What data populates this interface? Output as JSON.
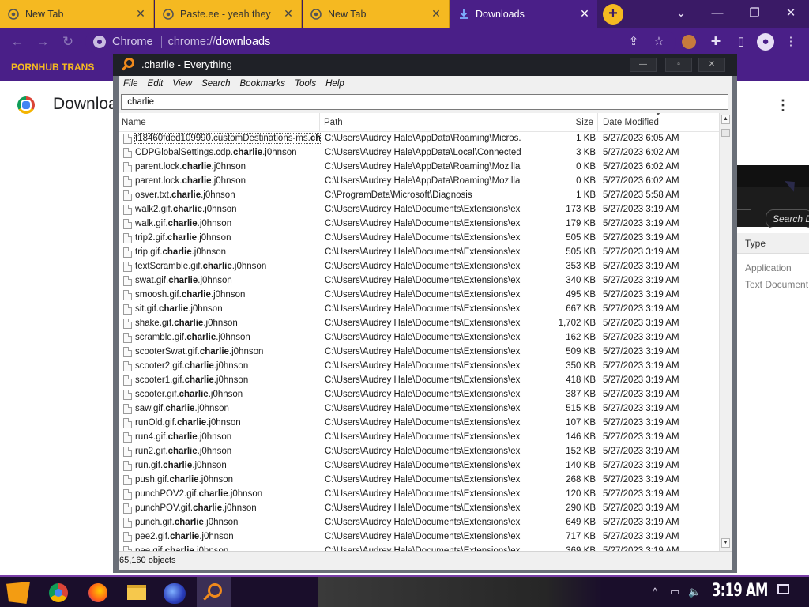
{
  "browser": {
    "tabs": [
      {
        "title": "New Tab",
        "active": false
      },
      {
        "title": "Paste.ee - yeah they ",
        "active": false
      },
      {
        "title": "New Tab",
        "active": false
      },
      {
        "title": "Downloads",
        "active": true
      }
    ],
    "newtab_label": "+",
    "window_controls": {
      "menu": "⌄",
      "minimize": "—",
      "maximize": "❐",
      "close": "✕"
    },
    "nav": {
      "back": "←",
      "forward": "→",
      "reload": "↻"
    },
    "omnibox": {
      "chip": "Chrome",
      "scheme": "chrome://",
      "host": "downloads"
    },
    "bookmark": "PORNHUB TRANS",
    "page_title": "Downloads",
    "page_menu": "⋮"
  },
  "background_window": {
    "search_placeholder": "Search Do",
    "column": "Type",
    "rows": [
      "Application",
      "Text Document"
    ]
  },
  "everything": {
    "title": ".charlie - Everything",
    "menu": [
      "File",
      "Edit",
      "View",
      "Search",
      "Bookmarks",
      "Tools",
      "Help"
    ],
    "query": ".charlie",
    "columns": {
      "name": "Name",
      "path": "Path",
      "size": "Size",
      "date": "Date Modified"
    },
    "rows": [
      {
        "pre": "f18460fded109990.customDestinations-ms.",
        "hl": "ch...",
        "post": "",
        "path": "C:\\Users\\Audrey Hale\\AppData\\Roaming\\Micros...",
        "size": "1 KB",
        "date": "5/27/2023 6:05 AM"
      },
      {
        "pre": "CDPGlobalSettings.cdp.",
        "hl": "charlie",
        "post": ".j0hnson",
        "path": "C:\\Users\\Audrey Hale\\AppData\\Local\\Connected...",
        "size": "3 KB",
        "date": "5/27/2023 6:02 AM"
      },
      {
        "pre": "parent.lock.",
        "hl": "charlie",
        "post": ".j0hnson",
        "path": "C:\\Users\\Audrey Hale\\AppData\\Roaming\\Mozilla...",
        "size": "0 KB",
        "date": "5/27/2023 6:02 AM"
      },
      {
        "pre": "parent.lock.",
        "hl": "charlie",
        "post": ".j0hnson",
        "path": "C:\\Users\\Audrey Hale\\AppData\\Roaming\\Mozilla...",
        "size": "0 KB",
        "date": "5/27/2023 6:02 AM"
      },
      {
        "pre": "osver.txt.",
        "hl": "charlie",
        "post": ".j0hnson",
        "path": "C:\\ProgramData\\Microsoft\\Diagnosis",
        "size": "1 KB",
        "date": "5/27/2023 5:58 AM"
      },
      {
        "pre": "walk2.gif.",
        "hl": "charlie",
        "post": ".j0hnson",
        "path": "C:\\Users\\Audrey Hale\\Documents\\Extensions\\ex...",
        "size": "173 KB",
        "date": "5/27/2023 3:19 AM"
      },
      {
        "pre": "walk.gif.",
        "hl": "charlie",
        "post": ".j0hnson",
        "path": "C:\\Users\\Audrey Hale\\Documents\\Extensions\\ex...",
        "size": "179 KB",
        "date": "5/27/2023 3:19 AM"
      },
      {
        "pre": "trip2.gif.",
        "hl": "charlie",
        "post": ".j0hnson",
        "path": "C:\\Users\\Audrey Hale\\Documents\\Extensions\\ex...",
        "size": "505 KB",
        "date": "5/27/2023 3:19 AM"
      },
      {
        "pre": "trip.gif.",
        "hl": "charlie",
        "post": ".j0hnson",
        "path": "C:\\Users\\Audrey Hale\\Documents\\Extensions\\ex...",
        "size": "505 KB",
        "date": "5/27/2023 3:19 AM"
      },
      {
        "pre": "textScramble.gif.",
        "hl": "charlie",
        "post": ".j0hnson",
        "path": "C:\\Users\\Audrey Hale\\Documents\\Extensions\\ex...",
        "size": "353 KB",
        "date": "5/27/2023 3:19 AM"
      },
      {
        "pre": "swat.gif.",
        "hl": "charlie",
        "post": ".j0hnson",
        "path": "C:\\Users\\Audrey Hale\\Documents\\Extensions\\ex...",
        "size": "340 KB",
        "date": "5/27/2023 3:19 AM"
      },
      {
        "pre": "smoosh.gif.",
        "hl": "charlie",
        "post": ".j0hnson",
        "path": "C:\\Users\\Audrey Hale\\Documents\\Extensions\\ex...",
        "size": "495 KB",
        "date": "5/27/2023 3:19 AM"
      },
      {
        "pre": "sit.gif.",
        "hl": "charlie",
        "post": ".j0hnson",
        "path": "C:\\Users\\Audrey Hale\\Documents\\Extensions\\ex...",
        "size": "667 KB",
        "date": "5/27/2023 3:19 AM"
      },
      {
        "pre": "shake.gif.",
        "hl": "charlie",
        "post": ".j0hnson",
        "path": "C:\\Users\\Audrey Hale\\Documents\\Extensions\\ex...",
        "size": "1,702 KB",
        "date": "5/27/2023 3:19 AM"
      },
      {
        "pre": "scramble.gif.",
        "hl": "charlie",
        "post": ".j0hnson",
        "path": "C:\\Users\\Audrey Hale\\Documents\\Extensions\\ex...",
        "size": "162 KB",
        "date": "5/27/2023 3:19 AM"
      },
      {
        "pre": "scooterSwat.gif.",
        "hl": "charlie",
        "post": ".j0hnson",
        "path": "C:\\Users\\Audrey Hale\\Documents\\Extensions\\ex...",
        "size": "509 KB",
        "date": "5/27/2023 3:19 AM"
      },
      {
        "pre": "scooter2.gif.",
        "hl": "charlie",
        "post": ".j0hnson",
        "path": "C:\\Users\\Audrey Hale\\Documents\\Extensions\\ex...",
        "size": "350 KB",
        "date": "5/27/2023 3:19 AM"
      },
      {
        "pre": "scooter1.gif.",
        "hl": "charlie",
        "post": ".j0hnson",
        "path": "C:\\Users\\Audrey Hale\\Documents\\Extensions\\ex...",
        "size": "418 KB",
        "date": "5/27/2023 3:19 AM"
      },
      {
        "pre": "scooter.gif.",
        "hl": "charlie",
        "post": ".j0hnson",
        "path": "C:\\Users\\Audrey Hale\\Documents\\Extensions\\ex...",
        "size": "387 KB",
        "date": "5/27/2023 3:19 AM"
      },
      {
        "pre": "saw.gif.",
        "hl": "charlie",
        "post": ".j0hnson",
        "path": "C:\\Users\\Audrey Hale\\Documents\\Extensions\\ex...",
        "size": "515 KB",
        "date": "5/27/2023 3:19 AM"
      },
      {
        "pre": "runOld.gif.",
        "hl": "charlie",
        "post": ".j0hnson",
        "path": "C:\\Users\\Audrey Hale\\Documents\\Extensions\\ex...",
        "size": "107 KB",
        "date": "5/27/2023 3:19 AM"
      },
      {
        "pre": "run4.gif.",
        "hl": "charlie",
        "post": ".j0hnson",
        "path": "C:\\Users\\Audrey Hale\\Documents\\Extensions\\ex...",
        "size": "146 KB",
        "date": "5/27/2023 3:19 AM"
      },
      {
        "pre": "run2.gif.",
        "hl": "charlie",
        "post": ".j0hnson",
        "path": "C:\\Users\\Audrey Hale\\Documents\\Extensions\\ex...",
        "size": "152 KB",
        "date": "5/27/2023 3:19 AM"
      },
      {
        "pre": "run.gif.",
        "hl": "charlie",
        "post": ".j0hnson",
        "path": "C:\\Users\\Audrey Hale\\Documents\\Extensions\\ex...",
        "size": "140 KB",
        "date": "5/27/2023 3:19 AM"
      },
      {
        "pre": "push.gif.",
        "hl": "charlie",
        "post": ".j0hnson",
        "path": "C:\\Users\\Audrey Hale\\Documents\\Extensions\\ex...",
        "size": "268 KB",
        "date": "5/27/2023 3:19 AM"
      },
      {
        "pre": "punchPOV2.gif.",
        "hl": "charlie",
        "post": ".j0hnson",
        "path": "C:\\Users\\Audrey Hale\\Documents\\Extensions\\ex...",
        "size": "120 KB",
        "date": "5/27/2023 3:19 AM"
      },
      {
        "pre": "punchPOV.gif.",
        "hl": "charlie",
        "post": ".j0hnson",
        "path": "C:\\Users\\Audrey Hale\\Documents\\Extensions\\ex...",
        "size": "290 KB",
        "date": "5/27/2023 3:19 AM"
      },
      {
        "pre": "punch.gif.",
        "hl": "charlie",
        "post": ".j0hnson",
        "path": "C:\\Users\\Audrey Hale\\Documents\\Extensions\\ex...",
        "size": "649 KB",
        "date": "5/27/2023 3:19 AM"
      },
      {
        "pre": "pee2.gif.",
        "hl": "charlie",
        "post": ".j0hnson",
        "path": "C:\\Users\\Audrey Hale\\Documents\\Extensions\\ex...",
        "size": "717 KB",
        "date": "5/27/2023 3:19 AM"
      },
      {
        "pre": "pee.gif.",
        "hl": "charlie",
        "post": ".j0hnson",
        "path": "C:\\Users\\Audrey Hale\\Documents\\Extensions\\ex...",
        "size": "369 KB",
        "date": "5/27/2023 3:19 AM"
      }
    ],
    "status": "65,160 objects"
  },
  "taskbar": {
    "icons": [
      "start-icon",
      "chrome-icon",
      "firefox-icon",
      "folder-icon",
      "globe-icon",
      "everything-icon"
    ],
    "tray": {
      "chevron": "^",
      "network": "▭",
      "volume": "🔈"
    },
    "clock": "3:19 AM"
  },
  "colors": {
    "accent": "#4a1f88",
    "tab": "#f5b921",
    "highlight": "#f08a1c"
  }
}
